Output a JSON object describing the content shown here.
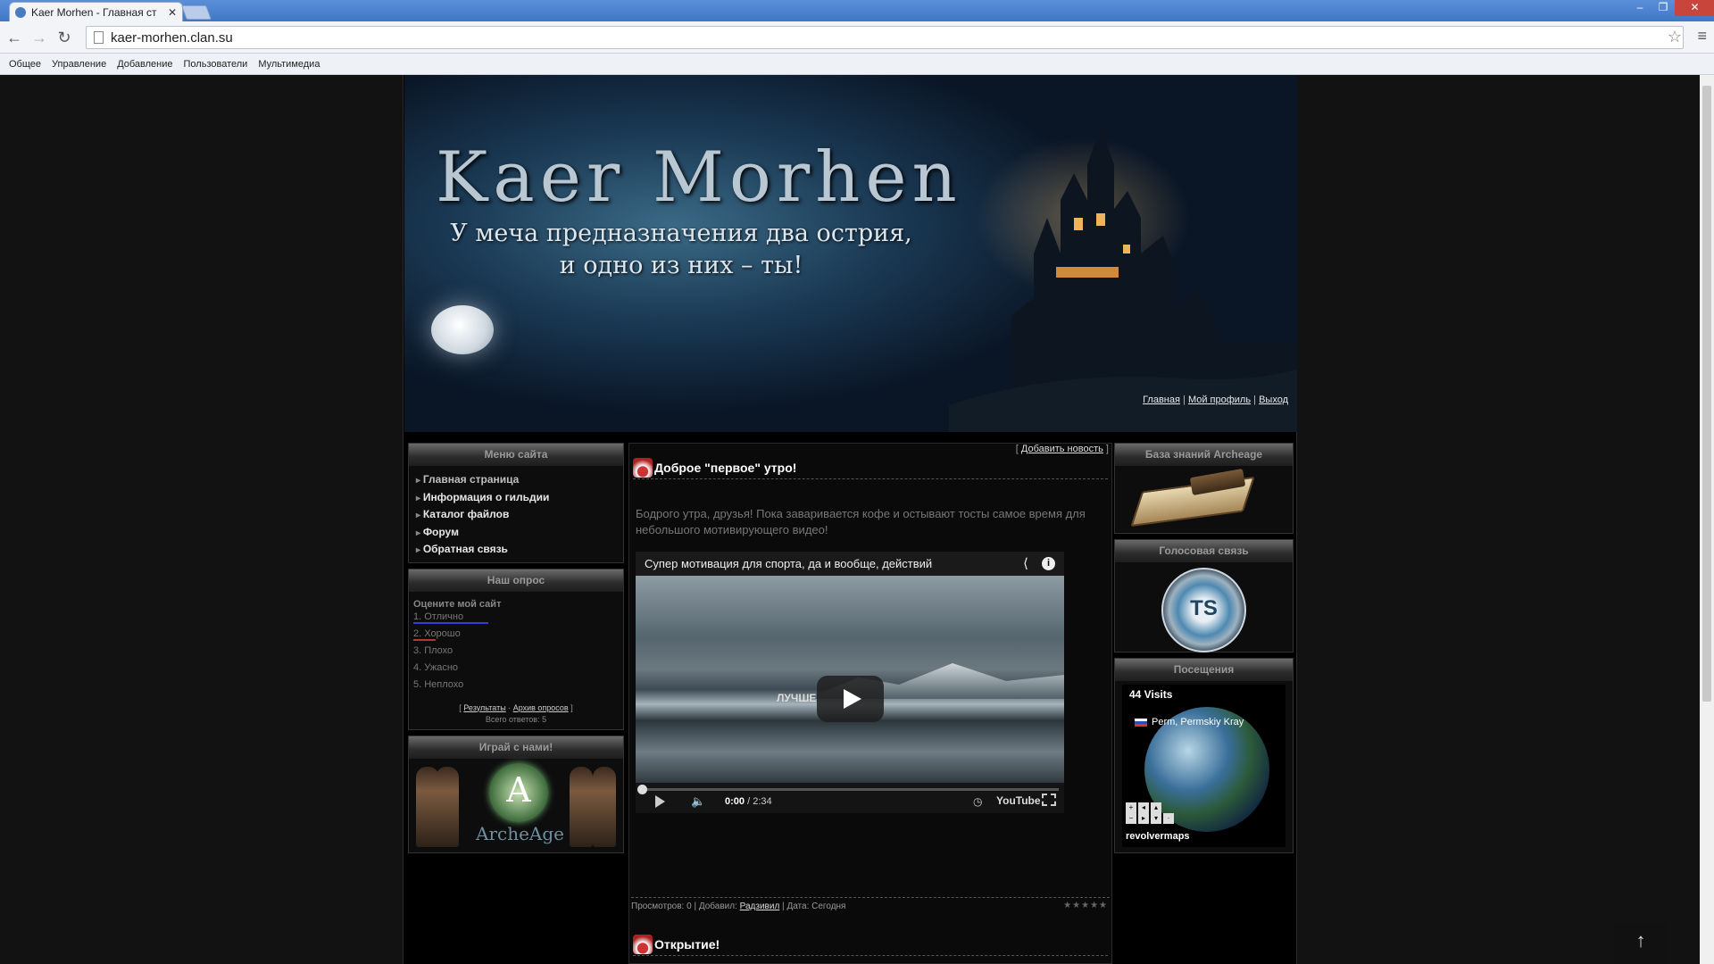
{
  "browser": {
    "tab_title": "Kaer Morhen - Главная ст",
    "url": "kaer-morhen.clan.su",
    "bookmarks": [
      "Общее",
      "Управление",
      "Добавление",
      "Пользователи",
      "Мультимедиа"
    ]
  },
  "header": {
    "logo": "Kaer Morhen",
    "tagline_line1": "У меча предназначения два острия,",
    "tagline_line2": "и одно из них – ты!",
    "links": [
      "Главная",
      "Мой профиль",
      "Выход"
    ]
  },
  "left": {
    "menu_title": "Меню сайта",
    "menu_items": [
      "Главная страница",
      "Информация о гильдии",
      "Каталог файлов",
      "Форум",
      "Обратная связь"
    ],
    "poll_title": "Наш опрос",
    "poll_question": "Оцените мой сайт",
    "poll_options": [
      "1. Отлично",
      "2. Хорошо",
      "3. Плохо",
      "4. Ужасно",
      "5. Неплохо"
    ],
    "poll_results_link": "Результаты",
    "poll_archive_link": "Архив опросов",
    "poll_total_label": "Всего ответов:",
    "poll_total": "5",
    "play_title": "Играй с нами!",
    "archeage_text": "ArcheAge",
    "archeage_letter": "A"
  },
  "center": {
    "add_news": "Добавить новость",
    "post1_title": "Доброе \"первое\" утро!",
    "post1_text": "Бодрого утра, друзья! Пока заваривается кофе и остывают тосты самое время для небольшого мотивирующего видео!",
    "video_title": "Супер мотивация для спорта, да и вообще, действий",
    "video_caption": "ЛУЧШЕ",
    "video_time_current": "0:00",
    "video_time_total": " / 2:34",
    "video_brand": "YouTube",
    "views_label": "Просмотров:",
    "views": "0",
    "added_label": "Добавил:",
    "author": "Радзивил",
    "date_label": "Дата:",
    "date": "Сегодня",
    "post2_title": "Открытие!"
  },
  "right": {
    "kb_title": "База знаний Archeage",
    "voice_title": "Голосовая связь",
    "ts_text": "TS",
    "visits_title": "Посещения",
    "visits_count": "44 Visits",
    "visits_location": "Perm, Permskiy Kray",
    "visits_brand": "revolvermaps"
  },
  "colors": {
    "poll_bar_1": "#3a3ad6",
    "poll_bar_2": "#b33a2a"
  }
}
